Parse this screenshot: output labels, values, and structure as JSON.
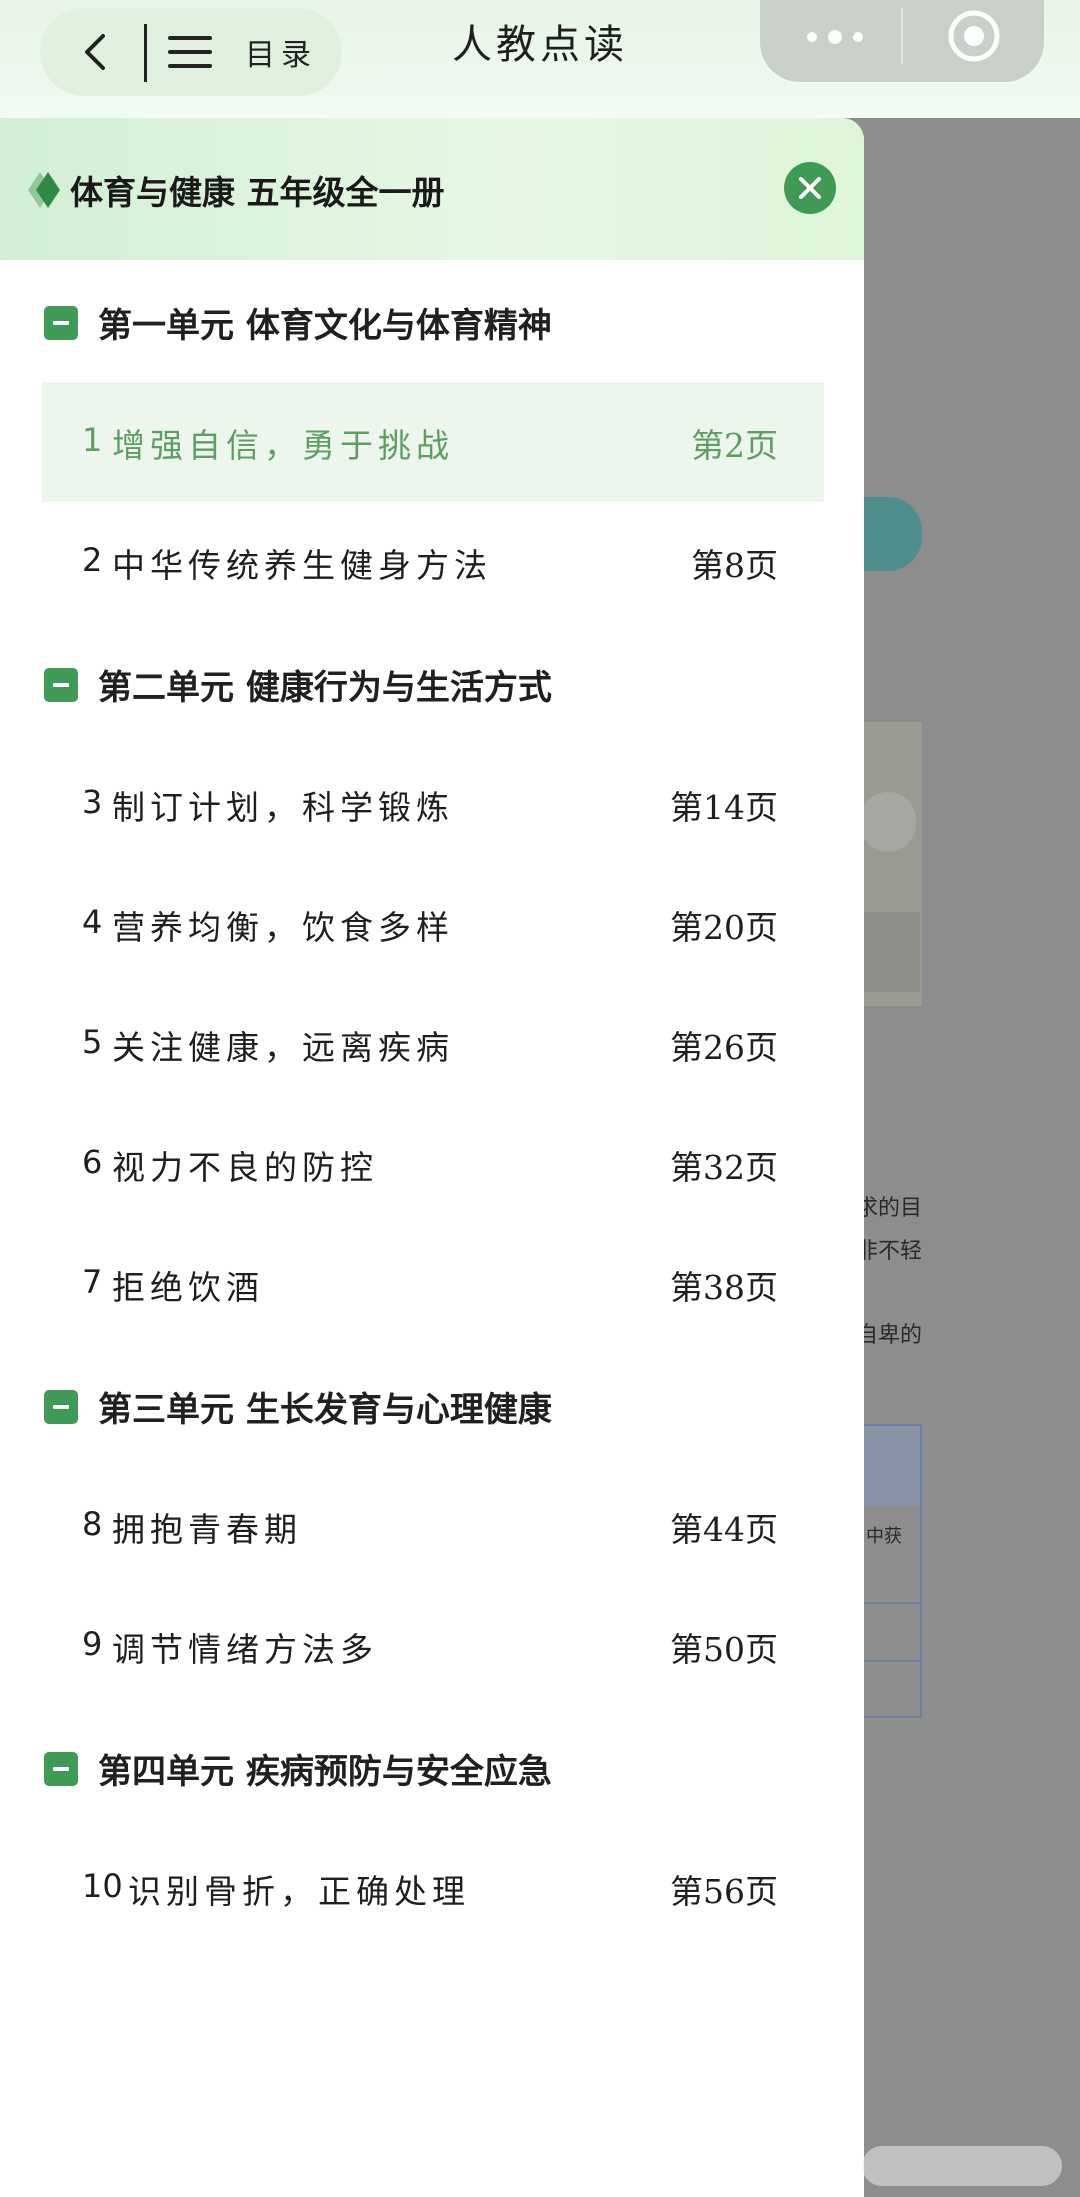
{
  "header": {
    "title": "人教点读",
    "nav_label": "目录",
    "icons": [
      "back-icon",
      "menu-icon",
      "more-icon",
      "target-icon"
    ]
  },
  "drawer": {
    "book_title": "体育与健康 五年级全一册",
    "accent_color": "#3e9a54",
    "units": [
      {
        "title": "第一单元 体育文化与体育精神",
        "lessons": [
          {
            "num": "1",
            "title": "增强自信，勇于挑战",
            "page": "第2页",
            "active": true
          },
          {
            "num": "2",
            "title": "中华传统养生健身方法",
            "page": "第8页"
          }
        ]
      },
      {
        "title": "第二单元 健康行为与生活方式",
        "lessons": [
          {
            "num": "3",
            "title": "制订计划，科学锻炼",
            "page": "第14页"
          },
          {
            "num": "4",
            "title": "营养均衡，饮食多样",
            "page": "第20页"
          },
          {
            "num": "5",
            "title": "关注健康，远离疾病",
            "page": "第26页"
          },
          {
            "num": "6",
            "title": "视力不良的防控",
            "page": "第32页"
          },
          {
            "num": "7",
            "title": "拒绝饮酒",
            "page": "第38页"
          }
        ]
      },
      {
        "title": "第三单元 生长发育与心理健康",
        "lessons": [
          {
            "num": "8",
            "title": "拥抱青春期",
            "page": "第44页"
          },
          {
            "num": "9",
            "title": "调节情绪方法多",
            "page": "第50页"
          }
        ]
      },
      {
        "title": "第四单元 疾病预防与安全应急",
        "lessons": [
          {
            "num": "10",
            "title": "识别骨折，正确处理",
            "page": "第56页"
          }
        ]
      }
    ]
  },
  "background_page": {
    "fragments": [
      "求的目",
      "非不轻",
      "自卑的",
      "中获"
    ]
  }
}
